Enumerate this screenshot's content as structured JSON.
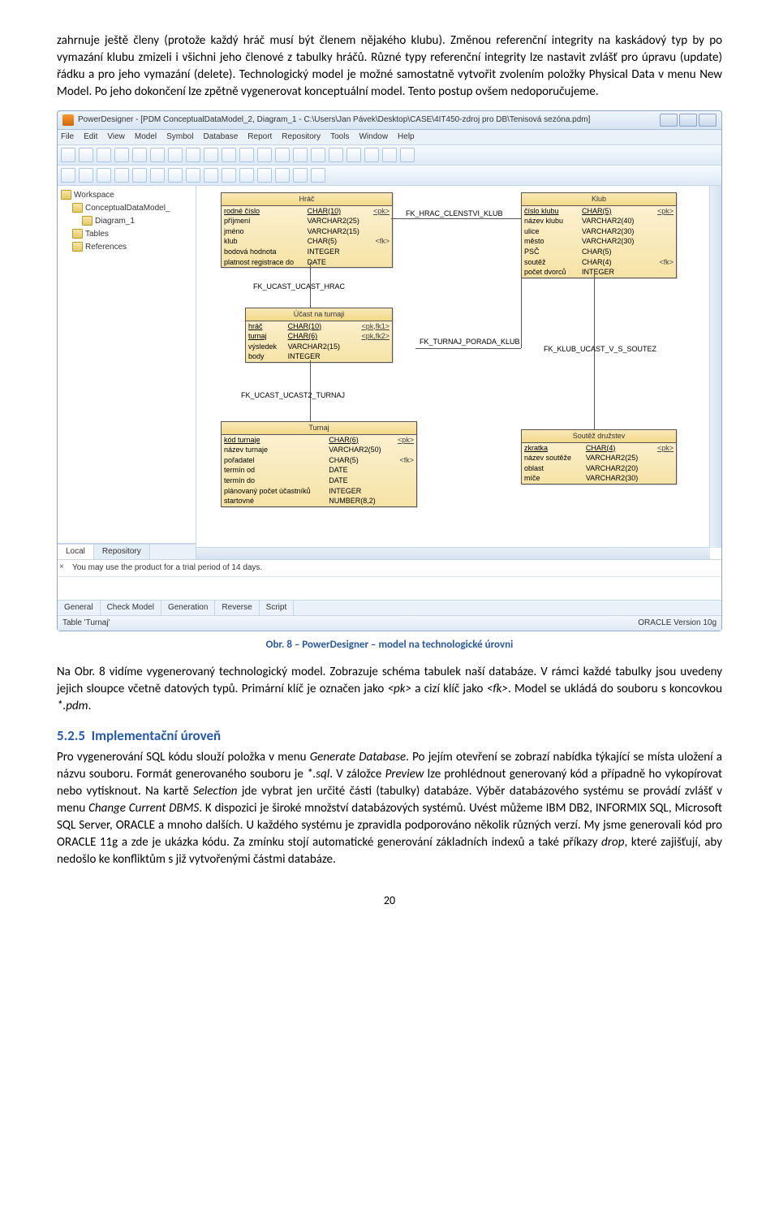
{
  "para1": "zahrnuje ještě členy (protože každý hráč musí být členem nějakého klubu). Změnou referenční integrity na kaskádový typ by po vymazání klubu zmizeli i všichni jeho členové z tabulky hráčů. Různé typy referenční integrity lze nastavit zvlášť pro úpravu (update) řádku a pro jeho vymazání (delete). Technologický model je možné samostatně vytvořit zvolením položky Physical Data v menu New Model. Po jeho dokončení lze zpětně vygenerovat konceptuální model. Tento postup ovšem nedoporučujeme.",
  "screenshot": {
    "title": "PowerDesigner - [PDM ConceptualDataModel_2, Diagram_1 - C:\\Users\\Jan Pávek\\Desktop\\CASE\\4IT450-zdroj pro DB\\Tenisová sezóna.pdm]",
    "menus": [
      "File",
      "Edit",
      "View",
      "Model",
      "Symbol",
      "Database",
      "Report",
      "Repository",
      "Tools",
      "Window",
      "Help"
    ],
    "tree": {
      "root": "Workspace",
      "items": [
        {
          "label": "ConceptualDataModel_",
          "indent": 1
        },
        {
          "label": "Diagram_1",
          "indent": 2
        },
        {
          "label": "Tables",
          "indent": 1
        },
        {
          "label": "References",
          "indent": 1
        }
      ]
    },
    "side_tabs": {
      "a": "Local",
      "b": "Repository"
    },
    "entities": {
      "hrac": {
        "title": "Hráč",
        "rows": [
          [
            "rodné číslo",
            "CHAR(10)",
            "<pk>"
          ],
          [
            "příjmení",
            "VARCHAR2(25)",
            ""
          ],
          [
            "jméno",
            "VARCHAR2(15)",
            ""
          ],
          [
            "klub",
            "CHAR(5)",
            "<fk>"
          ],
          [
            "bodová hodnota",
            "INTEGER",
            ""
          ],
          [
            "platnost registrace do",
            "DATE",
            ""
          ]
        ]
      },
      "ucast": {
        "title": "Účast na turnaji",
        "rows": [
          [
            "hráč",
            "CHAR(10)",
            "<pk,fk1>"
          ],
          [
            "turnaj",
            "CHAR(6)",
            "<pk,fk2>"
          ],
          [
            "výsledek",
            "VARCHAR2(15)",
            ""
          ],
          [
            "body",
            "INTEGER",
            ""
          ]
        ]
      },
      "turnaj": {
        "title": "Turnaj",
        "rows": [
          [
            "kód turnaje",
            "CHAR(6)",
            "<pk>"
          ],
          [
            "název turnaje",
            "VARCHAR2(50)",
            ""
          ],
          [
            "pořadatel",
            "CHAR(5)",
            "<fk>"
          ],
          [
            "termín od",
            "DATE",
            ""
          ],
          [
            "termín do",
            "DATE",
            ""
          ],
          [
            "plánovaný počet účastníků",
            "INTEGER",
            ""
          ],
          [
            "startovné",
            "NUMBER(8,2)",
            ""
          ]
        ]
      },
      "klub": {
        "title": "Klub",
        "rows": [
          [
            "číslo klubu",
            "CHAR(5)",
            "<pk>"
          ],
          [
            "název klubu",
            "VARCHAR2(40)",
            ""
          ],
          [
            "ulice",
            "VARCHAR2(30)",
            ""
          ],
          [
            "město",
            "VARCHAR2(30)",
            ""
          ],
          [
            "PSČ",
            "CHAR(5)",
            ""
          ],
          [
            "soutěž",
            "CHAR(4)",
            "<fk>"
          ],
          [
            "počet dvorců",
            "INTEGER",
            ""
          ]
        ]
      },
      "soutez": {
        "title": "Soutěž družstev",
        "rows": [
          [
            "zkratka",
            "CHAR(4)",
            "<pk>"
          ],
          [
            "název soutěže",
            "VARCHAR2(25)",
            ""
          ],
          [
            "oblast",
            "VARCHAR2(20)",
            ""
          ],
          [
            "míče",
            "VARCHAR2(30)",
            ""
          ]
        ]
      }
    },
    "rel_labels": {
      "a": "FK_HRAC_CLENSTVI_KLUB",
      "b": "FK_UCAST_UCAST_HRAC",
      "c": "FK_TURNAJ_PORADA_KLUB",
      "d": "FK_KLUB_UCAST_V_S_SOUTEZ",
      "e": "FK_UCAST_UCAST2_TURNAJ"
    },
    "message": "You may use the product for a trial period of 14 days.",
    "bottom_tabs": [
      "General",
      "Check Model",
      "Generation",
      "Reverse",
      "Script"
    ],
    "status_left": "Table 'Turnaj'",
    "status_right": "ORACLE Version 10g"
  },
  "fig_caption": "Obr. 8 – PowerDesigner – model na technologické úrovni",
  "para2_a": "Na Obr. 8 vidíme vygenerovaný technologický model. Zobrazuje schéma tabulek naší databáze. V rámci každé tabulky jsou uvedeny jejich sloupce včetně datových typů. Primární klíč je označen jako ",
  "para2_pk": "<pk>",
  "para2_b": " a cizí klíč jako ",
  "para2_fk": "<fk>",
  "para2_c": ". Model se ukládá do souboru s koncovkou ",
  "para2_ext": "*.pdm",
  "para2_d": ".",
  "section_num": "5.2.5",
  "section_title": "Implementační úroveň",
  "para3_a": "Pro vygenerování SQL kódu slouží položka v menu ",
  "para3_i1": "Generate Database",
  "para3_b": ". Po jejím otevření se zobrazí nabídka týkající se místa uložení a názvu souboru. Formát generovaného souboru je ",
  "para3_ext": "*.sql",
  "para3_c": ". V záložce ",
  "para3_i2": "Preview",
  "para3_d": " lze prohlédnout generovaný kód a případně ho vykopírovat nebo vytisknout. Na kartě ",
  "para3_i3": "Selection",
  "para3_e": " jde vybrat jen určité části (tabulky) databáze. Výběr databázového systému se provádí zvlášť v menu ",
  "para3_i4": "Change Current DBMS",
  "para3_f": ". K dispozici je široké množství databázových systémů. Uvést můžeme IBM DB2, INFORMIX SQL, Microsoft SQL Server, ORACLE a mnoho dalších. U každého systému je zpravidla podporováno několik různých verzí. My jsme generovali kód pro ORACLE 11g a zde je ukázka kódu. Za zmínku stojí automatické generování základních indexů a také příkazy ",
  "para3_i5": "drop",
  "para3_g": ", které zajišťují, aby nedošlo ke konfliktům s již vytvořenými částmi databáze.",
  "page_num": "20"
}
